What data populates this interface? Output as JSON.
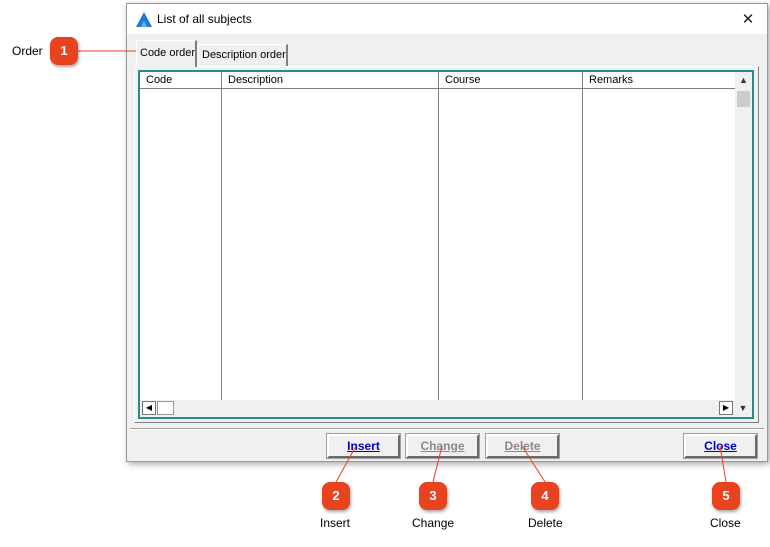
{
  "window": {
    "title": "List of all subjects",
    "close_glyph": "✕",
    "icon": "app-logo-icon"
  },
  "tabs": [
    {
      "label": "Code order",
      "active": true
    },
    {
      "label": "Description order",
      "active": false
    }
  ],
  "grid": {
    "columns": [
      "Code",
      "Description",
      "Course",
      "Remarks"
    ],
    "rows": []
  },
  "buttons": {
    "insert": "Insert",
    "change": "Change",
    "delete": "Delete",
    "close": "Close"
  },
  "callouts": [
    {
      "number": "1",
      "label": "Order"
    },
    {
      "number": "2",
      "label": "Insert"
    },
    {
      "number": "3",
      "label": "Change"
    },
    {
      "number": "4",
      "label": "Delete"
    },
    {
      "number": "5",
      "label": "Close"
    }
  ],
  "colors": {
    "callout": "#e8431e",
    "grid_border": "#2b8a8a",
    "enabled_button_text": "#0000cc",
    "disabled_button_text": "#8a8a8a"
  }
}
